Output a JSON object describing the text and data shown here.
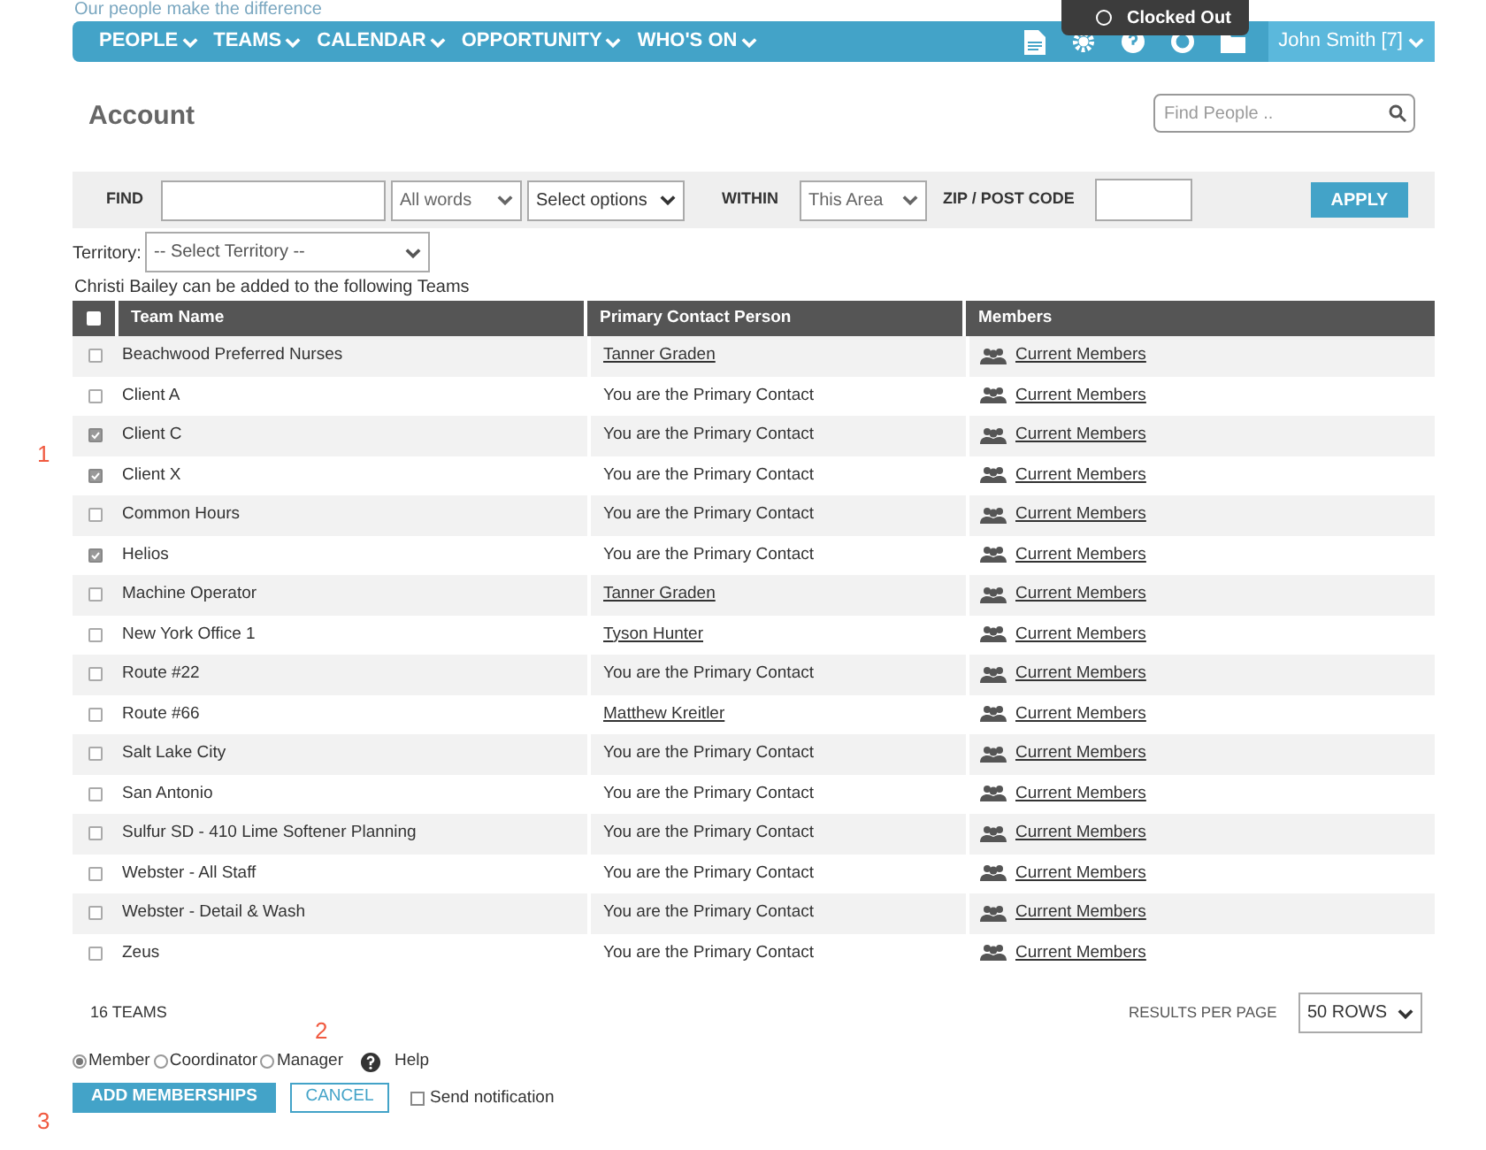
{
  "tagline": "Our people make the difference",
  "nav": {
    "menus": [
      "PEOPLE",
      "TEAMS",
      "CALENDAR",
      "OPPORTUNITY",
      "WHO'S ON"
    ],
    "user": "John Smith [7]"
  },
  "clock_tooltip": {
    "label": "Clocked Out"
  },
  "page_title": "Account",
  "find_people": {
    "placeholder": "Find People .."
  },
  "filters": {
    "find_label": "FIND",
    "match": "All words",
    "options": "Select options",
    "within_label": "WITHIN",
    "within": "This Area",
    "zip_label": "ZIP / POST CODE",
    "apply": "APPLY"
  },
  "territory": {
    "label": "Territory:",
    "value": "-- Select Territory --"
  },
  "caption": "Christi Bailey can be added to the following Teams",
  "table": {
    "columns": [
      "Team Name",
      "Primary Contact Person",
      "Members"
    ],
    "all_checked": false,
    "rows": [
      {
        "team": "Beachwood Preferred Nurses",
        "contact": "Tanner Graden",
        "kind": "link",
        "members": "Current Members",
        "checked": false
      },
      {
        "team": "Client A",
        "contact": "You are the Primary Contact",
        "kind": "text",
        "members": "Current Members",
        "checked": false
      },
      {
        "team": "Client C",
        "contact": "You are the Primary Contact",
        "kind": "text",
        "members": "Current Members",
        "checked": true
      },
      {
        "team": "Client X",
        "contact": "You are the Primary Contact",
        "kind": "text",
        "members": "Current Members",
        "checked": true
      },
      {
        "team": "Common Hours",
        "contact": "You are the Primary Contact",
        "kind": "text",
        "members": "Current Members",
        "checked": false
      },
      {
        "team": "Helios",
        "contact": "You are the Primary Contact",
        "kind": "text",
        "members": "Current Members",
        "checked": true
      },
      {
        "team": "Machine Operator",
        "contact": "Tanner Graden",
        "kind": "link",
        "members": "Current Members",
        "checked": false
      },
      {
        "team": "New York Office 1",
        "contact": "Tyson Hunter",
        "kind": "link",
        "members": "Current Members",
        "checked": false
      },
      {
        "team": "Route #22",
        "contact": "You are the Primary Contact",
        "kind": "text",
        "members": "Current Members",
        "checked": false
      },
      {
        "team": "Route #66",
        "contact": "Matthew Kreitler",
        "kind": "link",
        "members": "Current Members",
        "checked": false
      },
      {
        "team": "Salt Lake City",
        "contact": "You are the Primary Contact",
        "kind": "text",
        "members": "Current Members",
        "checked": false
      },
      {
        "team": "San Antonio",
        "contact": "You are the Primary Contact",
        "kind": "text",
        "members": "Current Members",
        "checked": false
      },
      {
        "team": "Sulfur SD - 410 Lime Softener Planning",
        "contact": "You are the Primary Contact",
        "kind": "text",
        "members": "Current Members",
        "checked": false
      },
      {
        "team": "Webster - All Staff",
        "contact": "You are the Primary Contact",
        "kind": "text",
        "members": "Current Members",
        "checked": false
      },
      {
        "team": "Webster - Detail & Wash",
        "contact": "You are the Primary Contact",
        "kind": "text",
        "members": "Current Members",
        "checked": false
      },
      {
        "team": "Zeus",
        "contact": "You are the Primary Contact",
        "kind": "text",
        "members": "Current Members",
        "checked": false
      }
    ]
  },
  "footer": {
    "count": "16 TEAMS",
    "per_page_label": "RESULTS PER PAGE",
    "per_page": "50 ROWS"
  },
  "roles": [
    {
      "label": "Member",
      "selected": true
    },
    {
      "label": "Coordinator",
      "selected": false
    },
    {
      "label": "Manager",
      "selected": false
    }
  ],
  "help": "Help",
  "add_button": "ADD MEMBERSHIPS",
  "cancel_button": "CANCEL",
  "send_notification": {
    "label": "Send notification",
    "checked": false
  },
  "annotations": [
    "1",
    "2",
    "3"
  ]
}
